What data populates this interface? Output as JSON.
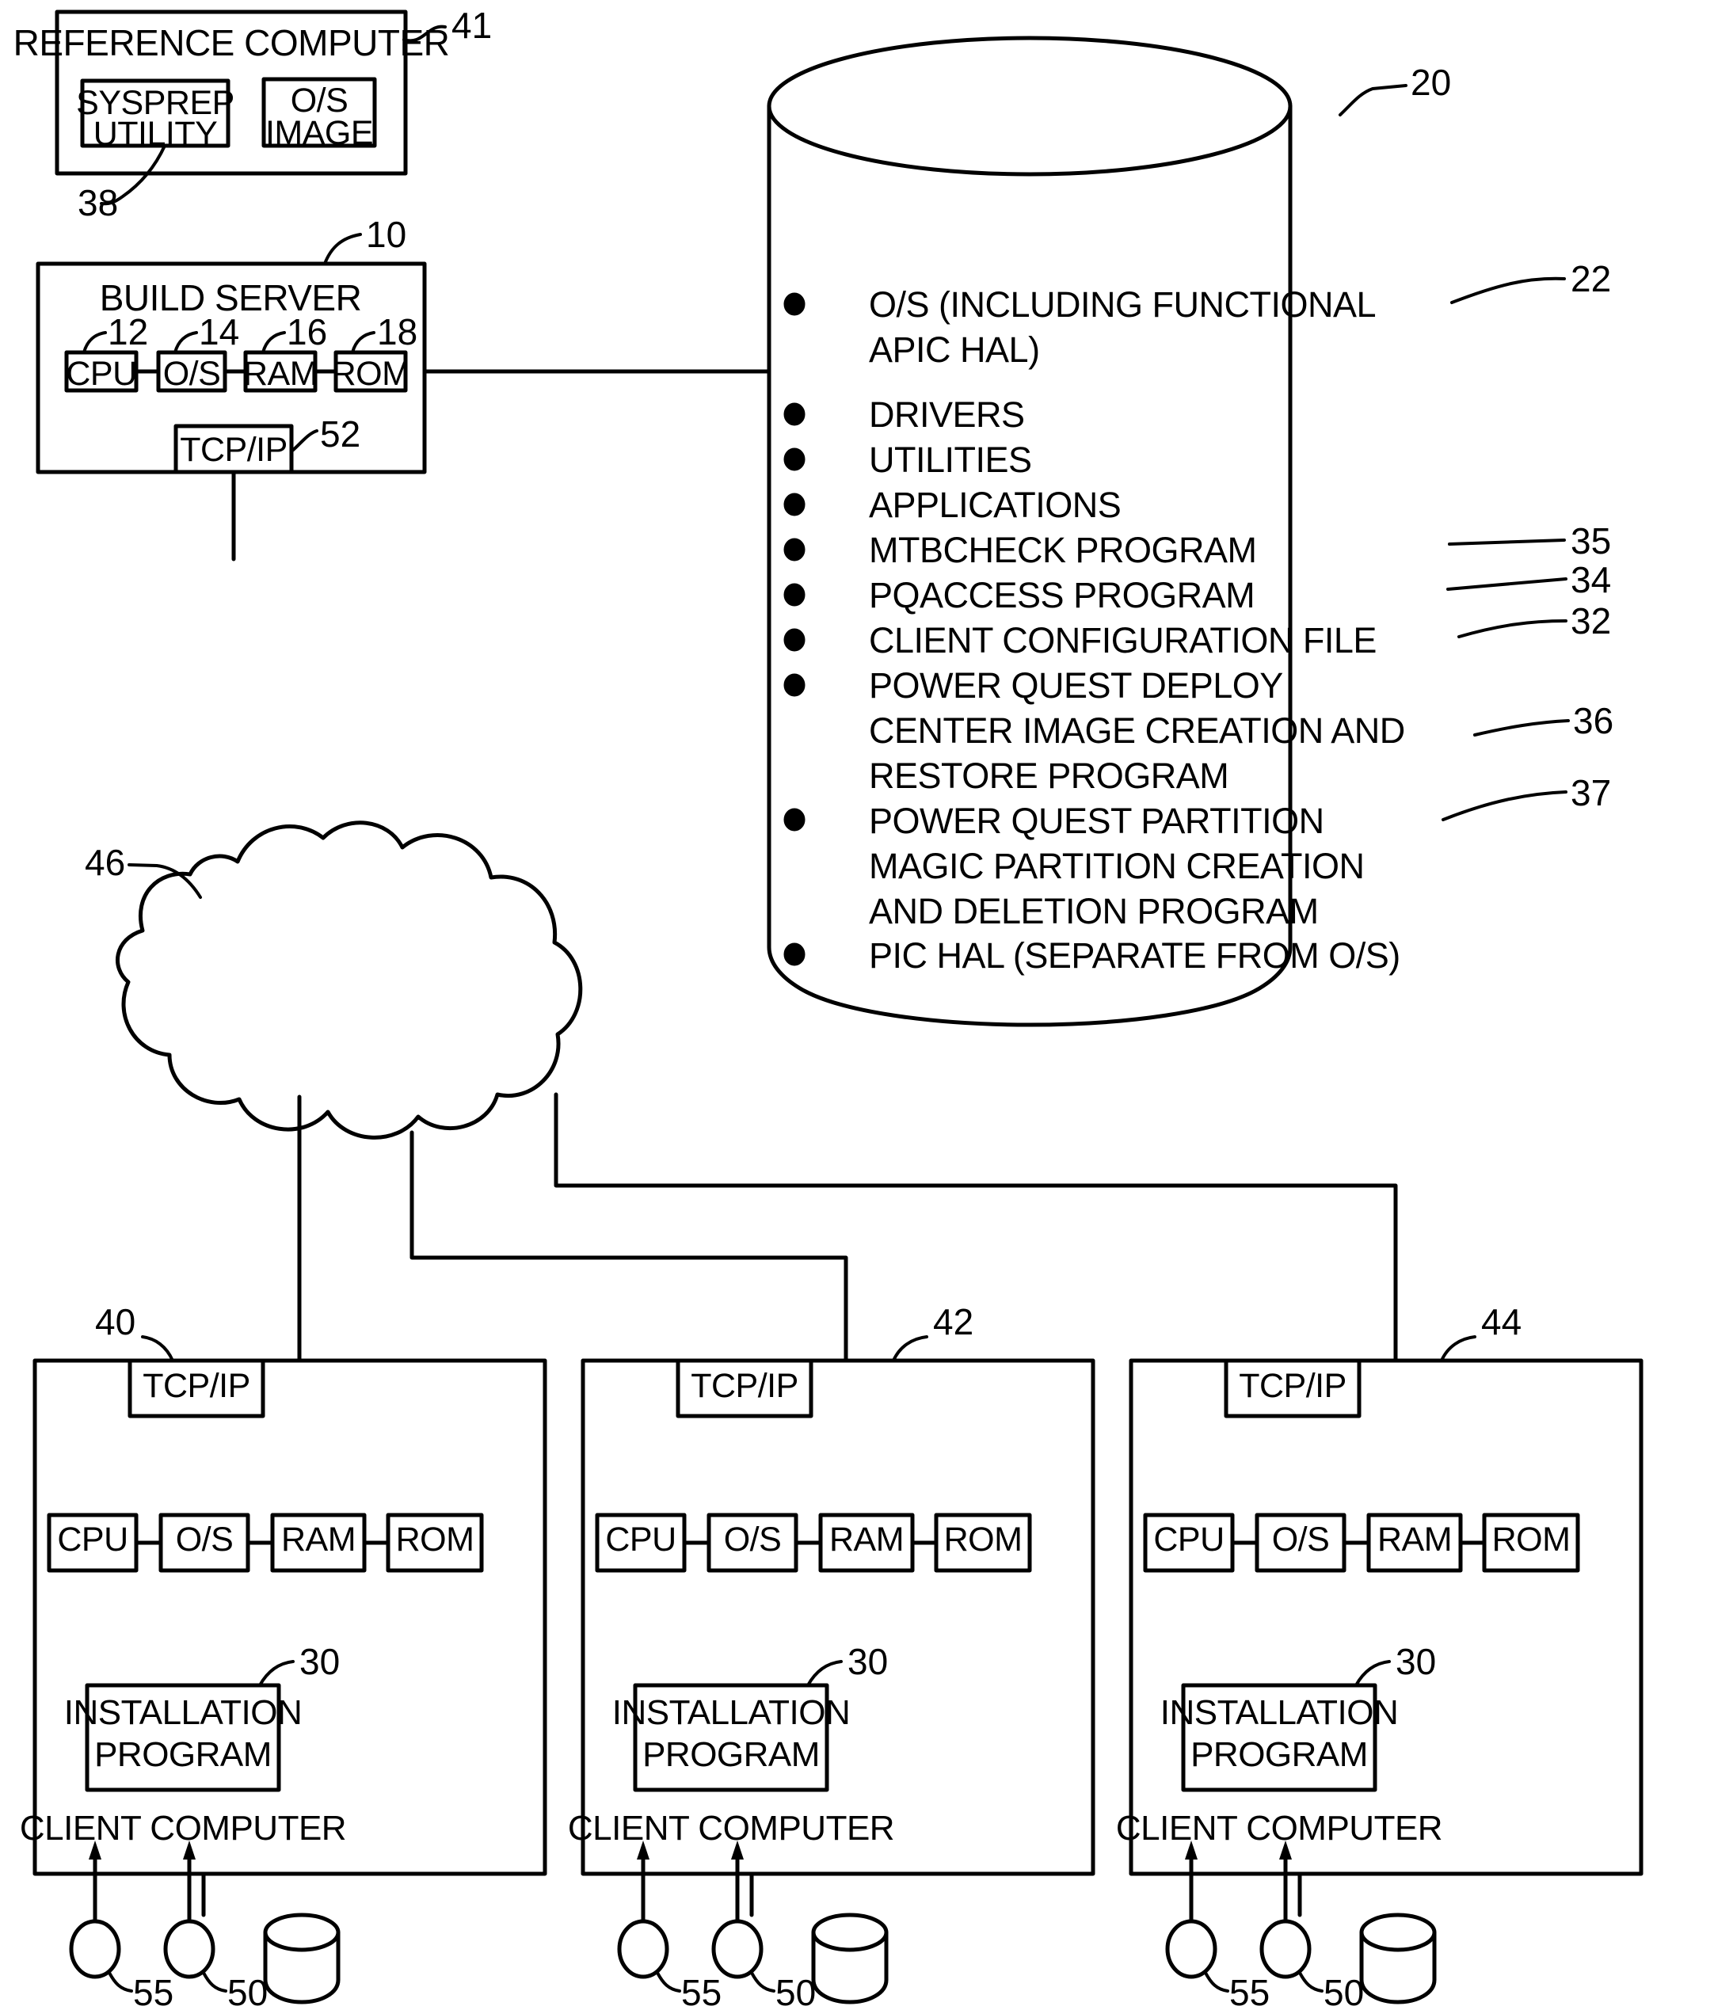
{
  "figure": {
    "reference_computer": {
      "title": "REFERENCE COMPUTER",
      "ref": "41",
      "sysprep": {
        "line1": "SYSPREP",
        "line2": "UTILITY",
        "ref": "38"
      },
      "os_image": {
        "line1": "O/S",
        "line2": "IMAGE"
      }
    },
    "build_server": {
      "title": "BUILD SERVER",
      "ref": "10",
      "components": [
        {
          "label": "CPU",
          "ref": "12"
        },
        {
          "label": "O/S",
          "ref": "14"
        },
        {
          "label": "RAM",
          "ref": "16"
        },
        {
          "label": "ROM",
          "ref": "18"
        }
      ],
      "network": {
        "label": "TCP/IP",
        "ref": "52"
      }
    },
    "repository": {
      "ref": "20",
      "items": [
        {
          "line1": "O/S (INCLUDING FUNCTIONAL",
          "line2": "APIC HAL)",
          "ref": "22"
        },
        {
          "line1": "DRIVERS",
          "line2": "",
          "ref": ""
        },
        {
          "line1": "UTILITIES",
          "line2": "",
          "ref": ""
        },
        {
          "line1": "APPLICATIONS",
          "line2": "",
          "ref": ""
        },
        {
          "line1": "MTBCHECK PROGRAM",
          "line2": "",
          "ref": "35"
        },
        {
          "line1": "PQACCESS PROGRAM",
          "line2": "",
          "ref": "34"
        },
        {
          "line1": "CLIENT CONFIGURATION FILE",
          "line2": "",
          "ref": "32"
        },
        {
          "line1": "POWER QUEST DEPLOY",
          "line2": "CENTER IMAGE CREATION AND",
          "line3": "RESTORE PROGRAM",
          "ref": "36"
        },
        {
          "line1": "POWER QUEST PARTITION",
          "line2": "MAGIC PARTITION CREATION",
          "line3": "AND DELETION PROGRAM",
          "ref": "37"
        },
        {
          "line1": "PIC HAL (SEPARATE FROM O/S)",
          "line2": "",
          "ref": ""
        }
      ]
    },
    "network_cloud": {
      "ref": "46"
    },
    "clients": [
      {
        "ref": "40",
        "network": "TCP/IP",
        "components": [
          "CPU",
          "O/S",
          "RAM",
          "ROM"
        ],
        "program": {
          "line1": "INSTALLATION",
          "line2": "PROGRAM",
          "ref": "30"
        },
        "title": "CLIENT COMPUTER",
        "peripherals": [
          {
            "ref": "55"
          },
          {
            "ref": "50"
          }
        ]
      },
      {
        "ref": "42",
        "network": "TCP/IP",
        "components": [
          "CPU",
          "O/S",
          "RAM",
          "ROM"
        ],
        "program": {
          "line1": "INSTALLATION",
          "line2": "PROGRAM",
          "ref": "30"
        },
        "title": "CLIENT COMPUTER",
        "peripherals": [
          {
            "ref": "55"
          },
          {
            "ref": "50"
          }
        ]
      },
      {
        "ref": "44",
        "network": "TCP/IP",
        "components": [
          "CPU",
          "O/S",
          "RAM",
          "ROM"
        ],
        "program": {
          "line1": "INSTALLATION",
          "line2": "PROGRAM",
          "ref": "30"
        },
        "title": "CLIENT COMPUTER",
        "peripherals": [
          {
            "ref": "55"
          },
          {
            "ref": "50"
          }
        ]
      }
    ],
    "colors": {
      "ink": "#000000",
      "paper": "#ffffff"
    }
  }
}
